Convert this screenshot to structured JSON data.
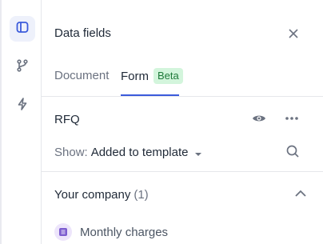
{
  "rail": {
    "items": [
      {
        "icon": "panel-icon",
        "active": true
      },
      {
        "icon": "branch-icon",
        "active": false
      },
      {
        "icon": "lightning-icon",
        "active": false
      }
    ]
  },
  "panel": {
    "title": "Data fields",
    "tabs": [
      {
        "label": "Document",
        "active": false
      },
      {
        "label": "Form",
        "active": true,
        "badge": "Beta"
      }
    ],
    "section": {
      "title": "RFQ",
      "show_label": "Show:",
      "show_value": "Added to template"
    },
    "group": {
      "title": "Your company",
      "count": "(1)",
      "items": [
        {
          "label": "Monthly charges",
          "icon": "list-icon"
        }
      ]
    }
  },
  "colors": {
    "accent": "#3b5bdb",
    "badge_bg": "#d3f5dc",
    "badge_text": "#1f7a3a",
    "field_icon_bg": "#ede5fb",
    "field_icon": "#7c5ccf"
  }
}
